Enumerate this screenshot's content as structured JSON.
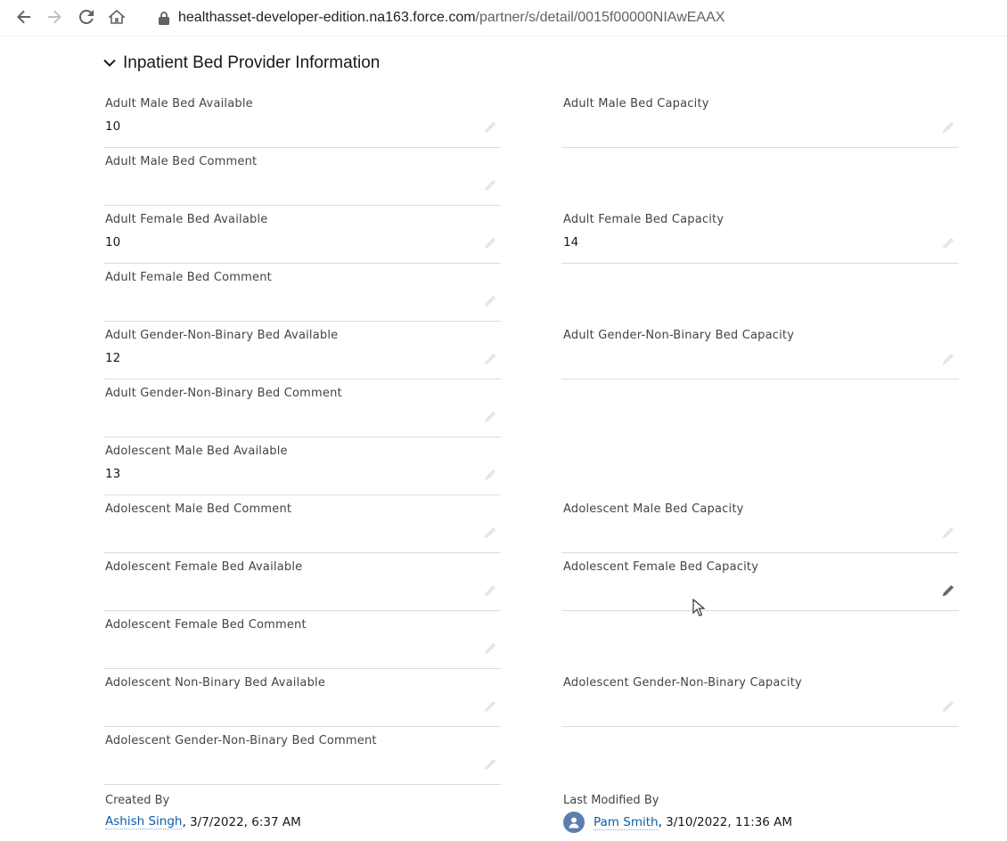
{
  "browser": {
    "url_host": "healthasset-developer-edition.na163.force.com",
    "url_path": "/partner/s/detail/0015f00000NIAwEAAX"
  },
  "section": {
    "title": "Inpatient Bed Provider Information"
  },
  "fields": {
    "adult_male_available": {
      "label": "Adult Male Bed Available",
      "value": "10"
    },
    "adult_male_capacity": {
      "label": "Adult Male Bed Capacity",
      "value": ""
    },
    "adult_male_comment": {
      "label": "Adult Male Bed Comment",
      "value": ""
    },
    "adult_female_available": {
      "label": "Adult Female Bed Available",
      "value": "10"
    },
    "adult_female_capacity": {
      "label": "Adult Female Bed Capacity",
      "value": "14"
    },
    "adult_female_comment": {
      "label": "Adult Female Bed Comment",
      "value": ""
    },
    "adult_gnb_available": {
      "label": "Adult Gender-Non-Binary Bed Available",
      "value": "12"
    },
    "adult_gnb_capacity": {
      "label": "Adult Gender-Non-Binary Bed Capacity",
      "value": ""
    },
    "adult_gnb_comment": {
      "label": "Adult Gender-Non-Binary Bed Comment",
      "value": ""
    },
    "adol_male_available": {
      "label": "Adolescent Male Bed Available",
      "value": "13"
    },
    "adol_male_comment": {
      "label": "Adolescent Male Bed Comment",
      "value": ""
    },
    "adol_male_capacity": {
      "label": "Adolescent Male Bed Capacity",
      "value": ""
    },
    "adol_female_available": {
      "label": "Adolescent Female Bed Available",
      "value": ""
    },
    "adol_female_capacity": {
      "label": "Adolescent Female Bed Capacity",
      "value": ""
    },
    "adol_female_comment": {
      "label": "Adolescent Female Bed Comment",
      "value": ""
    },
    "adol_nb_available": {
      "label": "Adolescent Non-Binary Bed Available",
      "value": ""
    },
    "adol_gnb_capacity": {
      "label": "Adolescent Gender-Non-Binary Capacity",
      "value": ""
    },
    "adol_gnb_comment": {
      "label": "Adolescent Gender-Non-Binary Bed Comment",
      "value": ""
    }
  },
  "meta": {
    "created_by_label": "Created By",
    "created_by_user": "Ashish Singh",
    "created_by_date": " , 3/7/2022, 6:37 AM",
    "modified_by_label": "Last Modified By",
    "modified_by_user": "Pam Smith",
    "modified_by_date": ", 3/10/2022, 11:36 AM"
  },
  "icons": {
    "back": "arrow-left-icon",
    "forward": "arrow-right-icon",
    "reload": "reload-icon",
    "home": "home-icon",
    "lock": "lock-icon",
    "chevron": "chevron-down-icon",
    "edit": "pencil-icon",
    "avatar": "user-avatar-icon"
  },
  "colors": {
    "link": "#0b5cab",
    "avatar": "#5b7fad",
    "divider": "#dddbda"
  }
}
